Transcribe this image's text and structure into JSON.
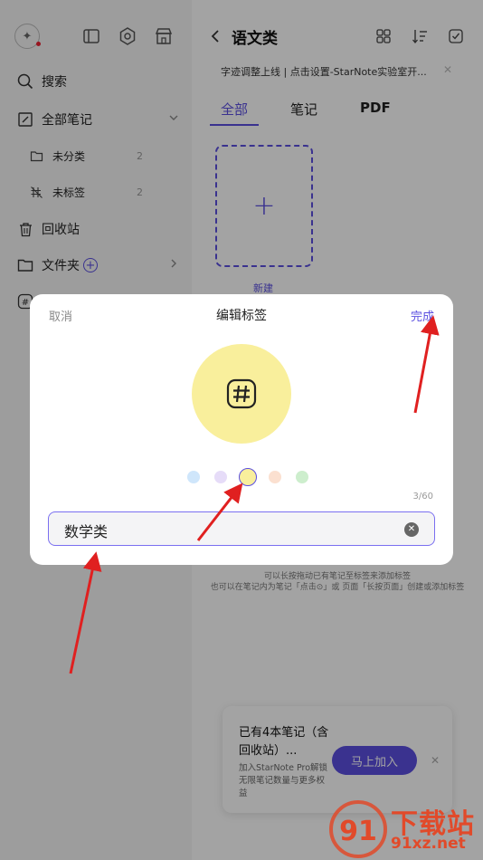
{
  "sidebar": {
    "search_label": "搜索",
    "all_notes_label": "全部笔记",
    "uncategorized": {
      "label": "未分类",
      "count": "2"
    },
    "untagged": {
      "label": "未标签",
      "count": "2"
    },
    "trash_label": "回收站",
    "folders_label": "文件夹"
  },
  "main": {
    "title": "语文类",
    "notice": "字迹调整上线 | 点击设置-StarNote实验室开...",
    "tabs": [
      {
        "label": "全部"
      },
      {
        "label": "笔记"
      },
      {
        "label": "PDF"
      }
    ],
    "new_label": "新建",
    "hint_line1": "可以长按拖动已有笔记至标签来添加标签",
    "hint_line2": "也可以在笔记内为笔记「点击⊙」或 页面「长按页面」创建或添加标签",
    "promo": {
      "title": "已有4本笔记（含回收站）...",
      "desc": "加入StarNote Pro解锁无限笔记数量与更多权益",
      "button": "马上加入"
    }
  },
  "dialog": {
    "cancel": "取消",
    "title": "编辑标签",
    "done": "完成",
    "preview_color": "#f9ef9c",
    "colors": [
      "#cfe6fb",
      "#e6dcf8",
      "#f9ef9c",
      "#fbe0d0",
      "#cdeecd"
    ],
    "selected_color_index": 2,
    "counter": "3/60",
    "name_value": "数学类"
  },
  "watermark": {
    "text": "下载站",
    "url": "91xz.net"
  },
  "colors": {
    "accent": "#5b4fe0",
    "arrow": "#e02020"
  }
}
